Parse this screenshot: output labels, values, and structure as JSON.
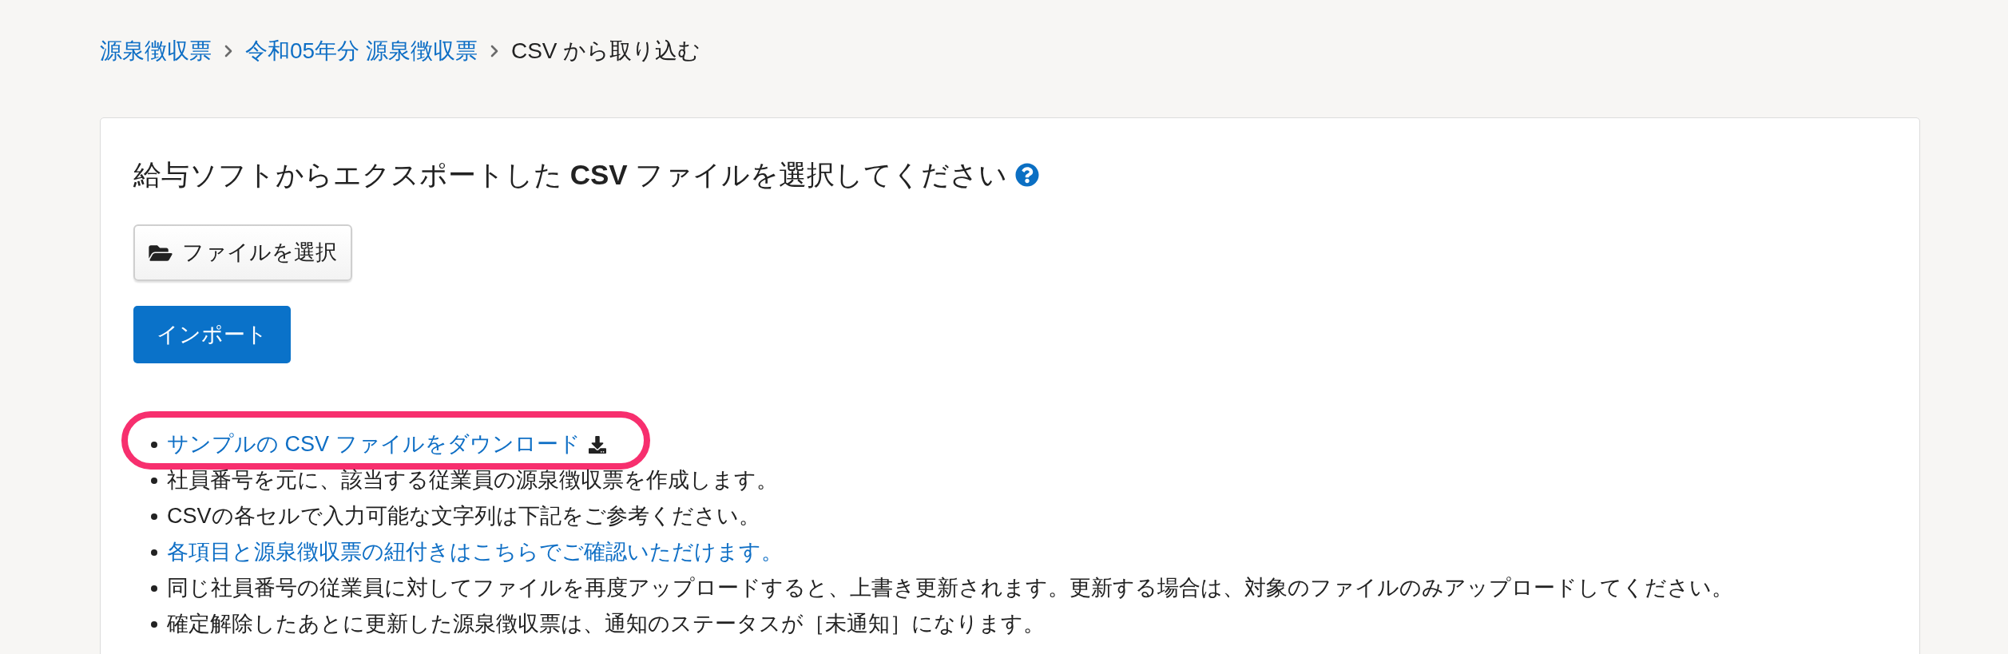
{
  "breadcrumb": [
    {
      "label": "源泉徴収票",
      "kind": "link"
    },
    {
      "label": "令和05年分 源泉徴収票",
      "kind": "link"
    },
    {
      "label": "CSV から取り込む",
      "kind": "current"
    }
  ],
  "card": {
    "title": "給与ソフトからエクスポートした **CSV** ファイルを選択してください",
    "file_button": "ファイルを選択",
    "import_button": "インポート",
    "notes": [
      {
        "kind": "download_link",
        "text": "サンプルの CSV ファイルをダウンロード",
        "highlighted": true
      },
      {
        "kind": "text",
        "text": "社員番号を元に、該当する従業員の源泉徴収票を作成します。",
        "highlighted": false
      },
      {
        "kind": "text",
        "text": "CSVの各セルで入力可能な文字列は下記をご参考ください。",
        "highlighted": false
      },
      {
        "kind": "link",
        "text": "各項目と源泉徴収票の紐付きはこちらでご確認いただけます。",
        "highlighted": false
      },
      {
        "kind": "text",
        "text": "同じ社員番号の従業員に対してファイルを再度アップロードすると、上書き更新されます。更新する場合は、対象のファイルのみアップロードしてください。",
        "highlighted": false
      },
      {
        "kind": "text",
        "text": "確定解除したあとに更新した源泉徴収票は、通知のステータスが［未通知］になります。",
        "highlighted": false
      }
    ]
  }
}
